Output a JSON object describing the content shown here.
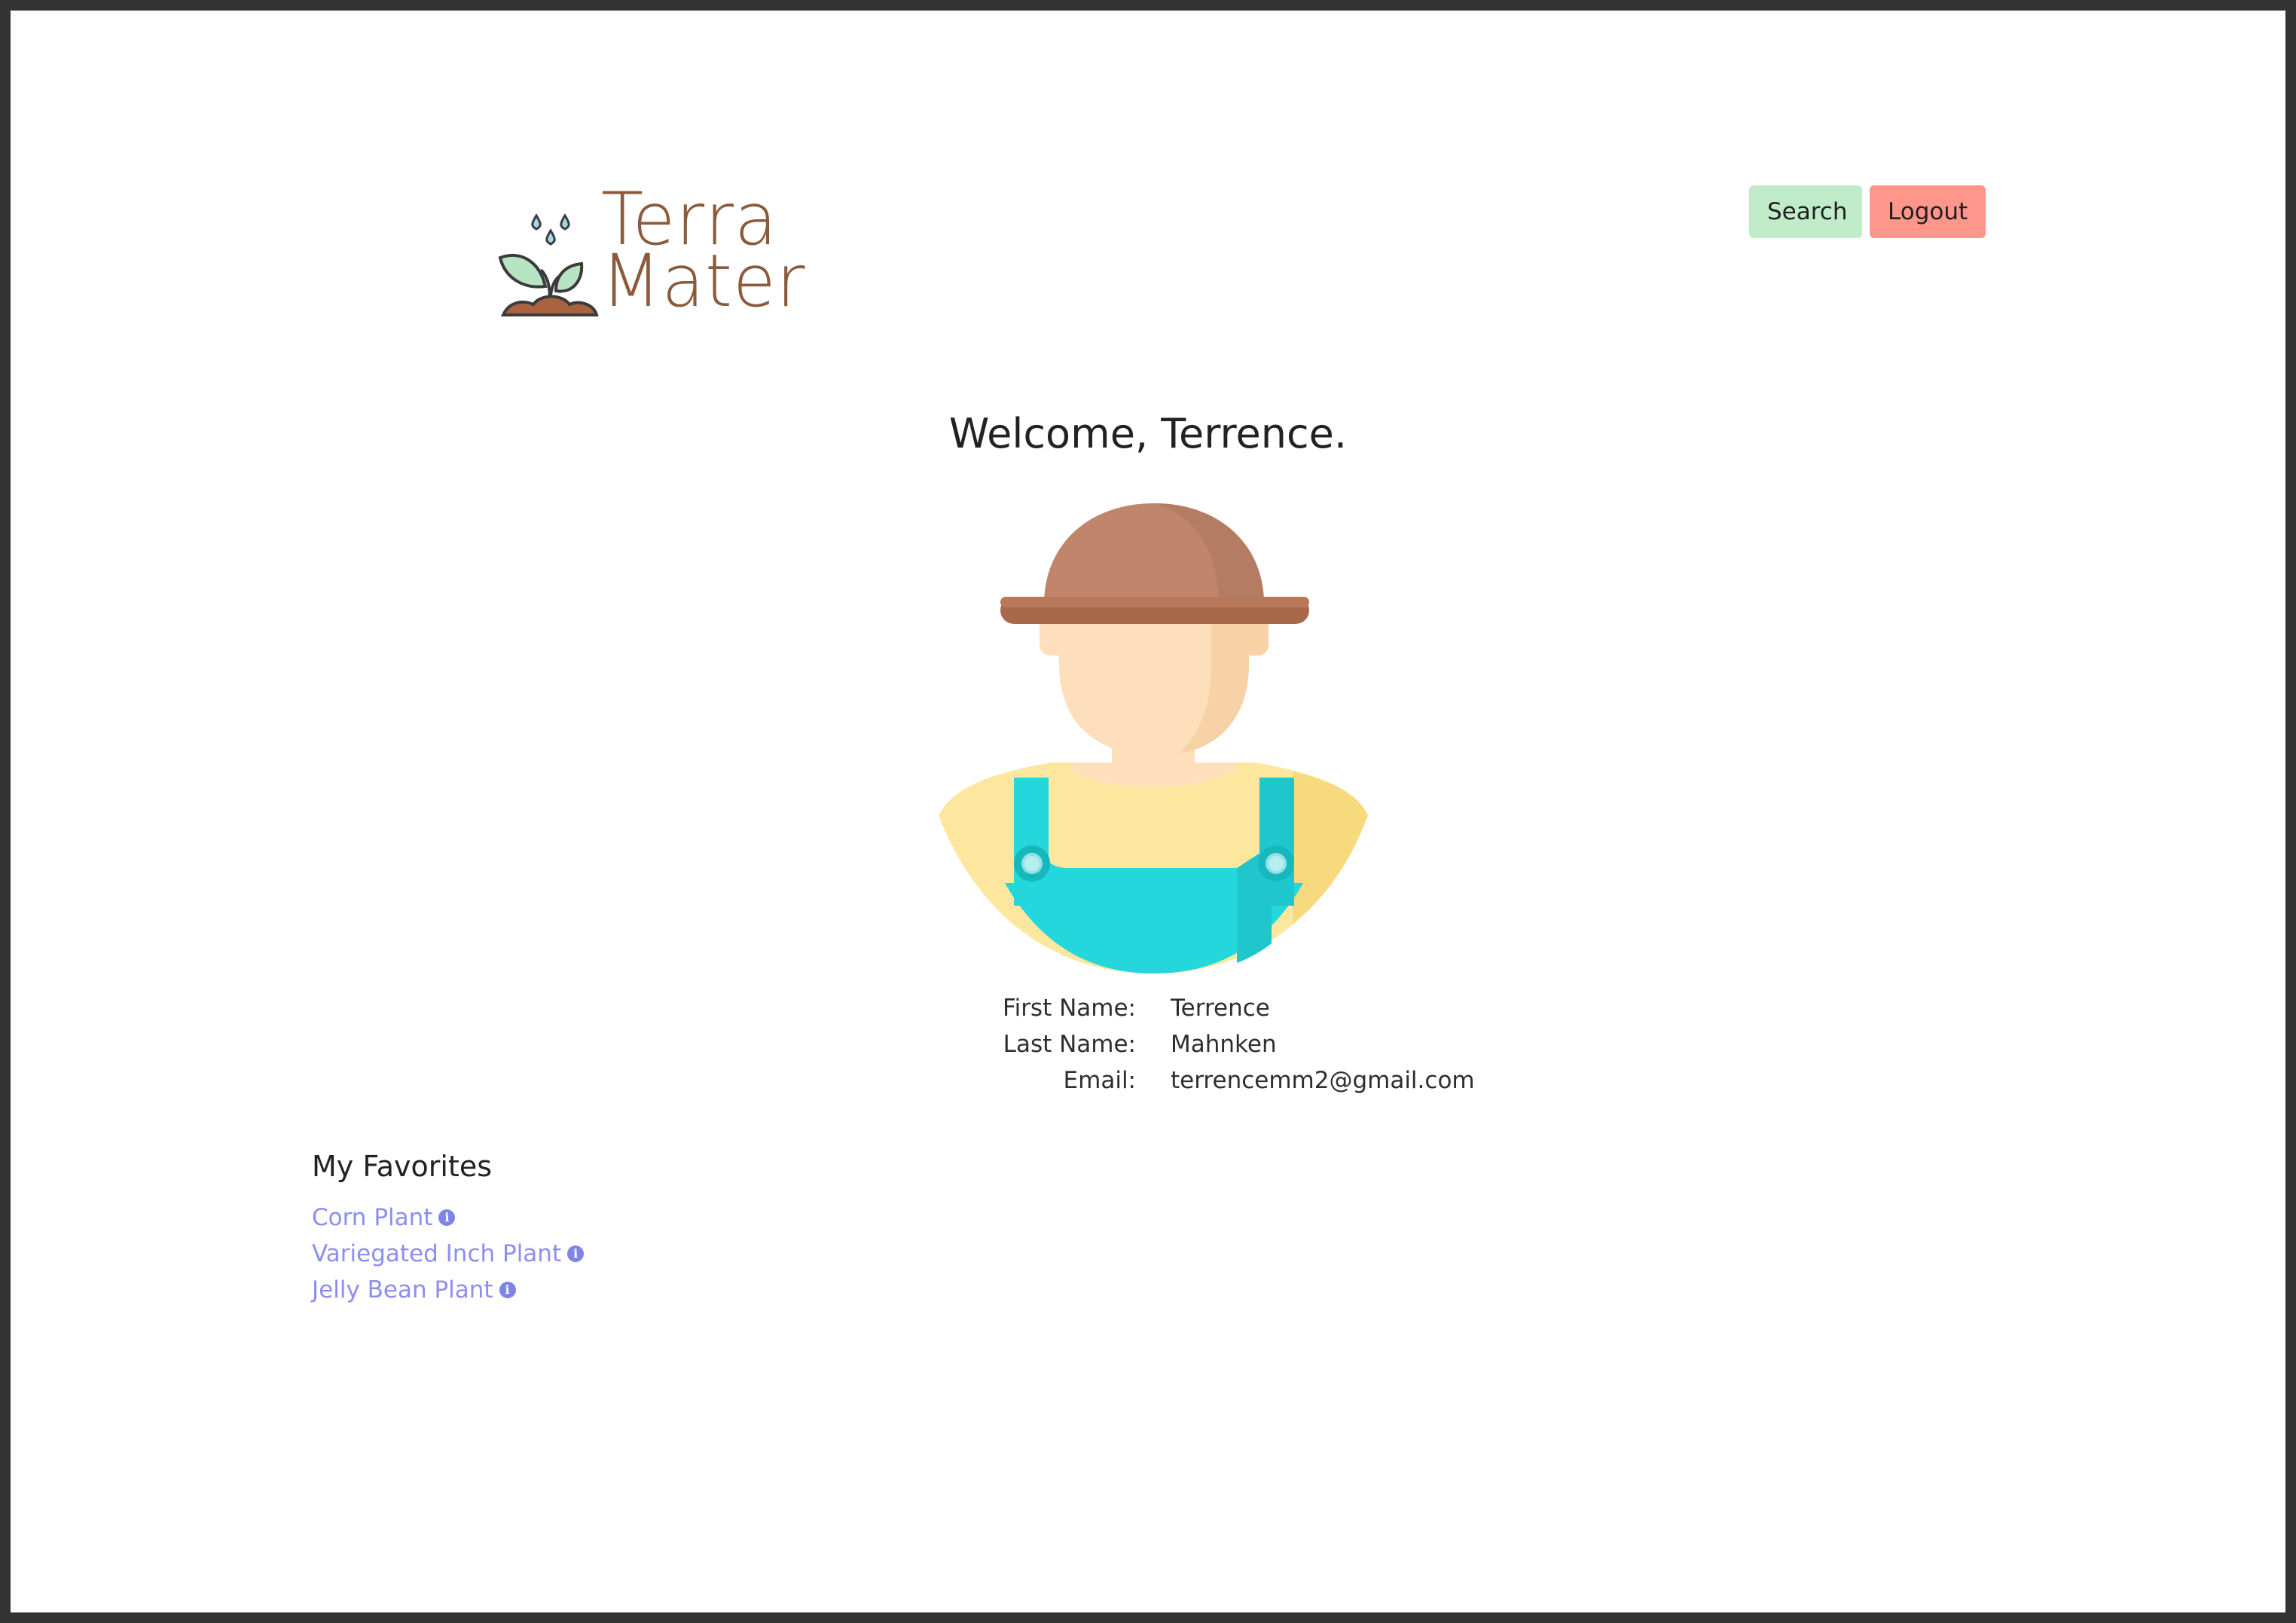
{
  "brand": {
    "line1": "Terra",
    "line2": "Mater"
  },
  "nav": {
    "search_label": "Search",
    "logout_label": "Logout"
  },
  "welcome": "Welcome, Terrence.",
  "profile": {
    "first_name_label": "First Name:",
    "first_name": "Terrence",
    "last_name_label": "Last Name:",
    "last_name": "Mahnken",
    "email_label": "Email:",
    "email": "terrencemm2@gmail.com"
  },
  "favorites": {
    "title": "My Favorites",
    "items": [
      {
        "label": "Corn Plant",
        "icon": "info-icon"
      },
      {
        "label": "Variegated Inch Plant",
        "icon": "info-icon"
      },
      {
        "label": "Jelly Bean Plant",
        "icon": "info-icon"
      }
    ]
  },
  "colors": {
    "search_button": "#c1ecca",
    "logout_button": "#ff968b",
    "link": "#8c8ef0",
    "brand_text": "#8a5a3b"
  }
}
